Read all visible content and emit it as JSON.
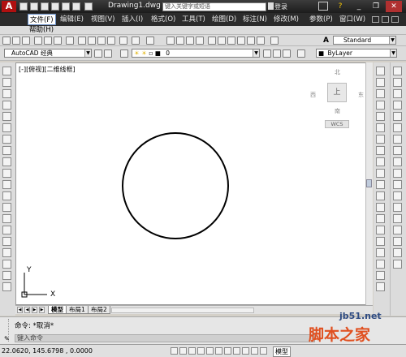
{
  "app": {
    "logo": "A",
    "title": "Drawing1.dwg"
  },
  "search": {
    "placeholder": "键入关键字或短语"
  },
  "user": {
    "login_label": "登录"
  },
  "window_controls": {
    "minimize": "_",
    "restore": "❐",
    "close": "✕",
    "help": "?"
  },
  "menu": {
    "items": [
      "文件(F)",
      "编辑(E)",
      "视图(V)",
      "插入(I)",
      "格式(O)",
      "工具(T)",
      "绘图(D)",
      "标注(N)",
      "修改(M)",
      "参数(P)",
      "窗口(W)"
    ],
    "help": "帮助(H)"
  },
  "toolbars": {
    "text_style": "Standard",
    "workspace": "AutoCAD 经典",
    "layer": "0",
    "color": "ByLayer",
    "linetype": "ByLayer"
  },
  "viewport": {
    "label": "[-][俯视][二维线框]",
    "viewcube": {
      "north": "北",
      "south": "南",
      "east": "东",
      "west": "西",
      "top": "上",
      "wcs": "WCS"
    },
    "ucs": {
      "x_label": "X",
      "y_label": "Y"
    }
  },
  "tabs": [
    "模型",
    "布局1",
    "布局2"
  ],
  "command": {
    "history": "命令: *取消*",
    "prompt_label": "键入命令",
    "prompt_icon": "✎"
  },
  "status": {
    "coords": "22.0620, 145.6798 , 0.0000",
    "model_label": "模型"
  },
  "watermark": {
    "main": "脚本之家",
    "url": "jb51.net"
  },
  "colors": {
    "accent": "#2b2b2b",
    "title_bar": "#1c1c1c",
    "canvas": "#ffffff",
    "watermark": "#e05020"
  }
}
